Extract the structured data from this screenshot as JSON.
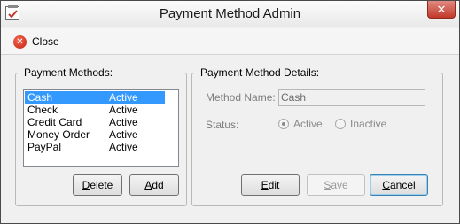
{
  "window": {
    "title": "Payment Method Admin",
    "close_glyph": "✕"
  },
  "toolbar": {
    "close_label": "Close",
    "close_glyph": "✕"
  },
  "methods_group": {
    "legend": "Payment Methods:",
    "items": [
      {
        "name": "Cash",
        "status": "Active",
        "selected": true
      },
      {
        "name": "Check",
        "status": "Active"
      },
      {
        "name": "Credit Card",
        "status": "Active"
      },
      {
        "name": "Money Order",
        "status": "Active"
      },
      {
        "name": "PayPal",
        "status": "Active"
      }
    ],
    "delete_label": "Delete",
    "add_label": "Add"
  },
  "details_group": {
    "legend": "Payment Method Details:",
    "method_name_label": "Method Name:",
    "method_name_value": "Cash",
    "status_label": "Status:",
    "status_options": [
      "Active",
      "Inactive"
    ],
    "status_selected": "Active",
    "edit_label": "Edit",
    "save_label": "Save",
    "cancel_label": "Cancel"
  }
}
